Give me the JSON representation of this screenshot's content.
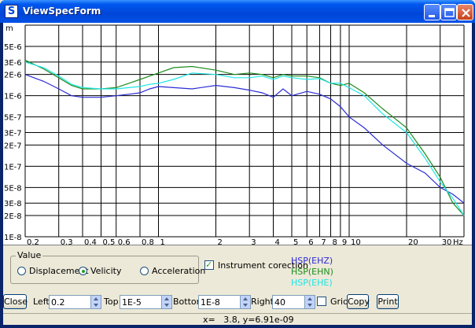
{
  "window": {
    "title": "ViewSpecForm",
    "icon_letter": "S"
  },
  "plot": {
    "y_unit": "m",
    "x_unit": "Hz"
  },
  "chart_data": {
    "type": "line",
    "xscale": "log",
    "yscale": "log",
    "xlim": [
      0.2,
      40
    ],
    "ylim": [
      1e-08,
      1e-05
    ],
    "xlabel": "Hz",
    "ylabel": "m",
    "grid": true,
    "x_ticks": [
      "0.2",
      "0.3",
      "0.4",
      "0.5",
      "0.6",
      "0.8",
      "1",
      "2",
      "3",
      "4",
      "5",
      "6",
      "7",
      "8",
      "9",
      "10",
      "20",
      "30"
    ],
    "y_ticks": [
      "5E-6",
      "3E-6",
      "2E-6",
      "1E-6",
      "5E-7",
      "3E-7",
      "2E-7",
      "1E-7",
      "5E-8",
      "3E-8",
      "2E-8",
      "1E-8"
    ],
    "legend_position": "bottom, under plot",
    "series": [
      {
        "name": "HSP(EHZ)",
        "color": "#2b2bd6",
        "x": [
          0.2,
          0.25,
          0.3,
          0.35,
          0.4,
          0.5,
          0.6,
          0.7,
          0.8,
          0.9,
          1.0,
          1.2,
          1.5,
          2.0,
          2.5,
          3.0,
          3.5,
          4.0,
          4.5,
          5.0,
          6.0,
          7.0,
          8.0,
          9.0,
          10,
          12,
          15,
          20,
          25,
          30,
          35,
          40
        ],
        "y": [
          2e-06,
          1.6e-06,
          1.25e-06,
          1e-06,
          9.5e-07,
          9.5e-07,
          1e-06,
          1.05e-06,
          1.1e-06,
          1.25e-06,
          1.35e-06,
          1.3e-06,
          1.25e-06,
          1.4e-06,
          1.3e-06,
          1.2e-06,
          1.1e-06,
          9.5e-07,
          1.25e-06,
          1e-06,
          1.15e-06,
          1.05e-06,
          9e-07,
          7e-07,
          5e-07,
          3.5e-07,
          2e-07,
          1.1e-07,
          8e-08,
          5e-08,
          4e-08,
          3e-08
        ]
      },
      {
        "name": "HSP(EHN)",
        "color": "#1e8c1e",
        "x": [
          0.2,
          0.25,
          0.3,
          0.35,
          0.4,
          0.5,
          0.6,
          0.7,
          0.8,
          0.9,
          1.0,
          1.2,
          1.5,
          2.0,
          2.5,
          3.0,
          3.5,
          4.0,
          4.5,
          5.0,
          6.0,
          7.0,
          8.0,
          9.0,
          10,
          12,
          15,
          20,
          25,
          30,
          35,
          40
        ],
        "y": [
          3.2e-06,
          2.4e-06,
          1.8e-06,
          1.4e-06,
          1.25e-06,
          1.25e-06,
          1.3e-06,
          1.5e-06,
          1.7e-06,
          1.9e-06,
          2.1e-06,
          2.5e-06,
          2.6e-06,
          2.3e-06,
          2e-06,
          2.1e-06,
          2e-06,
          1.8e-06,
          2e-06,
          1.9e-06,
          1.9e-06,
          1.8e-06,
          1.5e-06,
          1.4e-06,
          1.5e-06,
          1.1e-06,
          6.5e-07,
          3.5e-07,
          1.5e-07,
          7e-08,
          3e-08,
          2e-08
        ]
      },
      {
        "name": "HSP(EHE)",
        "color": "#1ee6e6",
        "x": [
          0.2,
          0.25,
          0.3,
          0.35,
          0.4,
          0.5,
          0.6,
          0.7,
          0.8,
          0.9,
          1.0,
          1.2,
          1.5,
          2.0,
          2.5,
          3.0,
          3.5,
          4.0,
          4.5,
          5.0,
          6.0,
          7.0,
          8.0,
          9.0,
          10,
          12,
          15,
          20,
          25,
          30,
          35,
          40
        ],
        "y": [
          3e-06,
          2.5e-06,
          1.9e-06,
          1.45e-06,
          1.3e-06,
          1.25e-06,
          1.25e-06,
          1.3e-06,
          1.35e-06,
          1.45e-06,
          1.5e-06,
          1.7e-06,
          2.1e-06,
          2e-06,
          1.8e-06,
          1.8e-06,
          1.9e-06,
          1.7e-06,
          1.9e-06,
          1.8e-06,
          1.7e-06,
          1.75e-06,
          1.5e-06,
          1.5e-06,
          1.3e-06,
          1e-06,
          5.5e-07,
          3e-07,
          1.3e-07,
          6e-08,
          3.5e-08,
          2e-08
        ]
      }
    ]
  },
  "value_group": {
    "caption": "Value",
    "options": [
      "Displacement",
      "Velicity",
      "Acceleration"
    ],
    "selected": "Velicity"
  },
  "instrument_correction": {
    "label": "Instrument corection",
    "checked": true
  },
  "legend": [
    "HSP(EHZ)",
    "HSP(EHN)",
    "HSP(EHE)"
  ],
  "toolbar": {
    "close_label": "Close",
    "left_label": "Left",
    "left_value": "0.2",
    "top_label": "Top",
    "top_value": "1E-5",
    "bottom_label": "Bottom",
    "bottom_value": "1E-8",
    "right_label": "Right",
    "right_value": "40",
    "grid_label": "Grid",
    "grid_checked": false,
    "copy_label": "Copy",
    "print_label": "Print"
  },
  "status": {
    "text": "x=   3.8, y=6.91e-09"
  }
}
